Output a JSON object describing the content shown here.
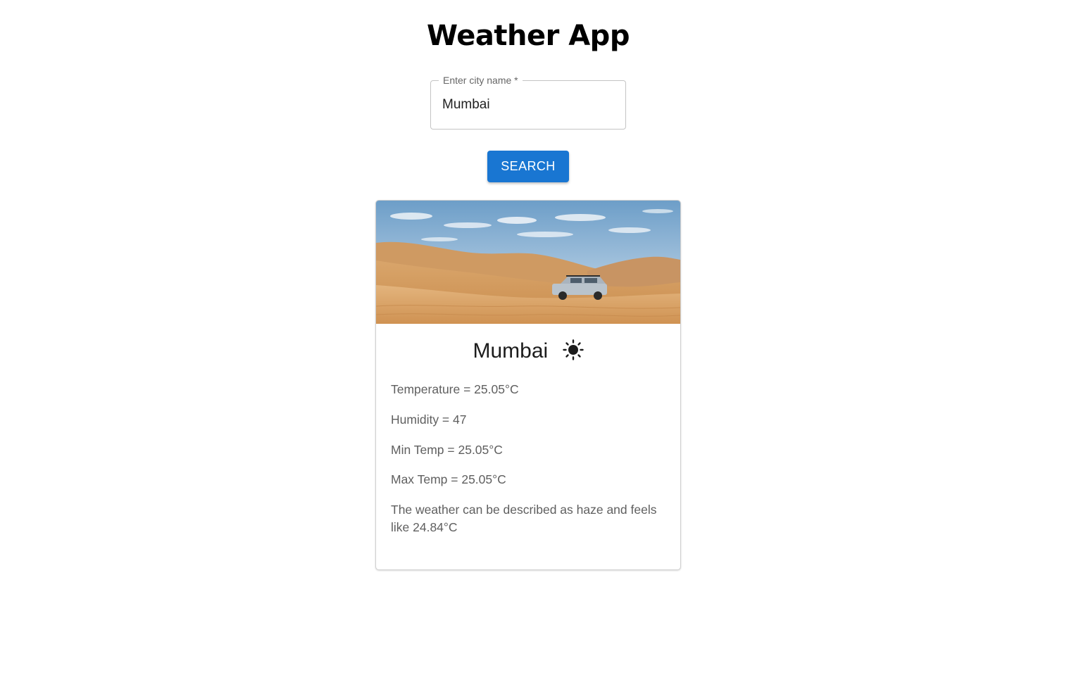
{
  "header": {
    "title": "Weather App"
  },
  "search": {
    "label": "Enter city name *",
    "value": "Mumbai",
    "button_label": "SEARCH"
  },
  "card": {
    "city": "Mumbai",
    "weather_icon": "sun-icon",
    "lines": {
      "temperature": "Temperature = 25.05°C",
      "humidity": "Humidity = 47",
      "min_temp": "Min Temp = 25.05°C",
      "max_temp": "Max Temp = 25.05°C",
      "description": "The weather can be described as haze and feels like 24.84°C"
    }
  },
  "colors": {
    "accent": "#1976d2",
    "text_primary": "#1c1c1c",
    "text_secondary": "#5f5f5f"
  }
}
